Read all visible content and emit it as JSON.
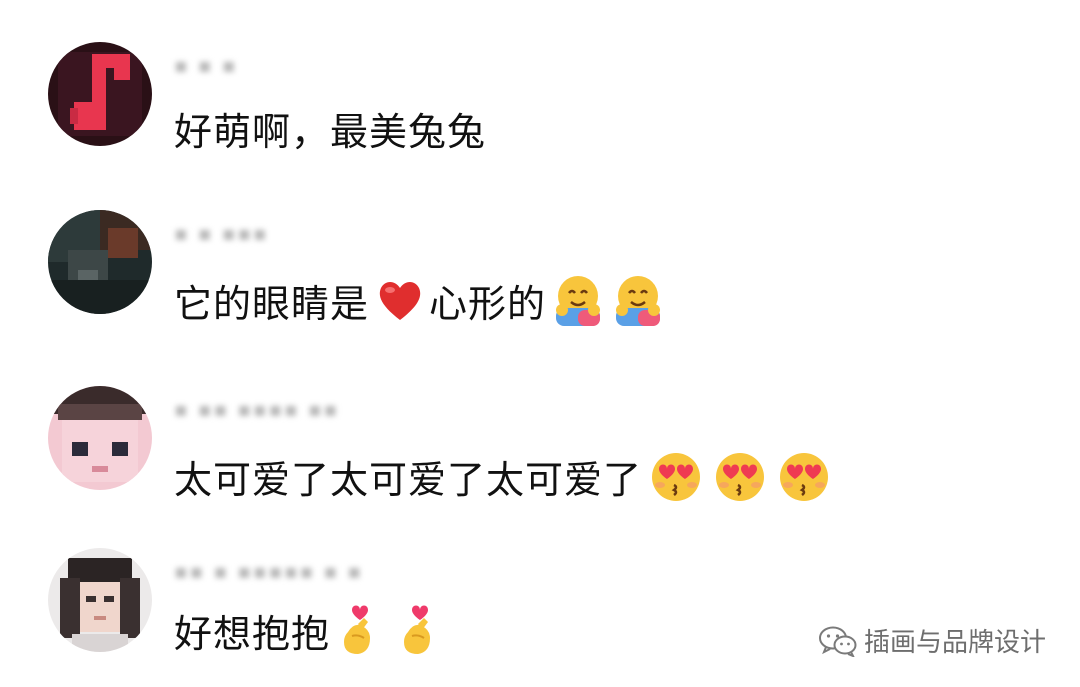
{
  "comments": [
    {
      "username": "▪ ▪ ▪",
      "text": "好萌啊，最美兔兔",
      "avatar": "music-note-avatar",
      "emojis": []
    },
    {
      "username": "▪ ▪ ▪▪▪",
      "text": "它的眼睛是",
      "text_after": "心形的",
      "avatar": "dark-photo-avatar",
      "emojis": [
        "red-heart",
        "hugging-face",
        "hugging-face"
      ]
    },
    {
      "username": "▪ ▪▪ ▪▪▪▪ ▪▪",
      "text": "太可爱了太可爱了太可爱了",
      "avatar": "cartoon-face-avatar",
      "emojis": [
        "heart-eyes-kiss-face",
        "heart-eyes-kiss-face",
        "heart-eyes-kiss-face"
      ]
    },
    {
      "username": "▪▪ ▪ ▪▪▪▪▪ ▪ ▪",
      "text": "好想抱抱",
      "avatar": "person-photo-avatar",
      "emojis": [
        "finger-heart",
        "finger-heart"
      ]
    }
  ],
  "watermark": {
    "text": "插画与品牌设计",
    "icon": "wechat-icon"
  }
}
